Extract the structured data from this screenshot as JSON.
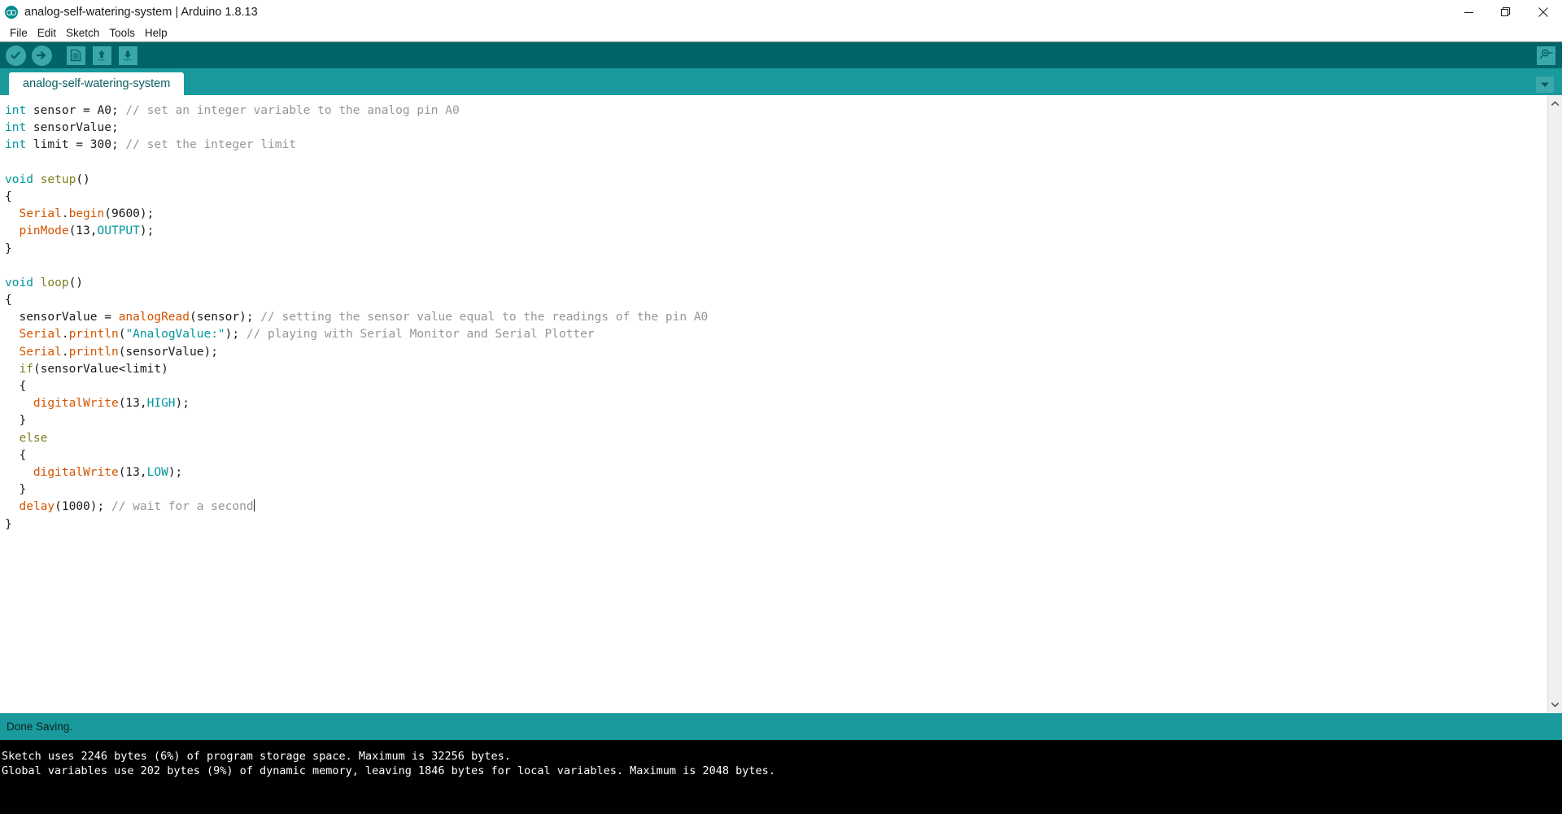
{
  "window": {
    "title": "analog-self-watering-system | Arduino 1.8.13",
    "logo_icon": "arduino-logo-icon",
    "controls": {
      "minimize": "minimize-icon",
      "restore": "restore-icon",
      "close": "close-icon"
    }
  },
  "menu": {
    "items": [
      {
        "label": "File"
      },
      {
        "label": "Edit"
      },
      {
        "label": "Sketch"
      },
      {
        "label": "Tools"
      },
      {
        "label": "Help"
      }
    ]
  },
  "toolbar": {
    "buttons": [
      {
        "name": "verify-button",
        "icon": "checkmark-icon",
        "label": "Verify"
      },
      {
        "name": "upload-button",
        "icon": "right-arrow-icon",
        "label": "Upload"
      },
      {
        "name": "new-button",
        "icon": "new-document-icon",
        "label": "New"
      },
      {
        "name": "open-button",
        "icon": "up-arrow-icon",
        "label": "Open"
      },
      {
        "name": "save-button",
        "icon": "down-arrow-icon",
        "label": "Save"
      }
    ],
    "serial_monitor": {
      "icon": "magnifier-icon",
      "label": "Serial Monitor"
    }
  },
  "tabs": {
    "items": [
      {
        "label": "analog-self-watering-system",
        "active": true
      }
    ],
    "dropdown_icon": "chevron-down-icon"
  },
  "editor": {
    "lines": [
      [
        {
          "t": "int",
          "c": "k-type"
        },
        {
          "t": " sensor = A0; ",
          "c": "k-plain"
        },
        {
          "t": "// set an integer variable to the analog pin A0",
          "c": "k-comment"
        }
      ],
      [
        {
          "t": "int",
          "c": "k-type"
        },
        {
          "t": " sensorValue;",
          "c": "k-plain"
        }
      ],
      [
        {
          "t": "int",
          "c": "k-type"
        },
        {
          "t": " limit = 300; ",
          "c": "k-plain"
        },
        {
          "t": "// set the integer limit",
          "c": "k-comment"
        }
      ],
      [],
      [
        {
          "t": "void",
          "c": "k-type"
        },
        {
          "t": " ",
          "c": "k-plain"
        },
        {
          "t": "setup",
          "c": "k-ctrl"
        },
        {
          "t": "()",
          "c": "k-plain"
        }
      ],
      [
        {
          "t": "{",
          "c": "k-plain"
        }
      ],
      [
        {
          "t": "  ",
          "c": "k-plain"
        },
        {
          "t": "Serial",
          "c": "k-func"
        },
        {
          "t": ".",
          "c": "k-plain"
        },
        {
          "t": "begin",
          "c": "k-func"
        },
        {
          "t": "(9600);",
          "c": "k-plain"
        }
      ],
      [
        {
          "t": "  ",
          "c": "k-plain"
        },
        {
          "t": "pinMode",
          "c": "k-func"
        },
        {
          "t": "(13,",
          "c": "k-plain"
        },
        {
          "t": "OUTPUT",
          "c": "k-const"
        },
        {
          "t": ");",
          "c": "k-plain"
        }
      ],
      [
        {
          "t": "}",
          "c": "k-plain"
        }
      ],
      [],
      [
        {
          "t": "void",
          "c": "k-type"
        },
        {
          "t": " ",
          "c": "k-plain"
        },
        {
          "t": "loop",
          "c": "k-ctrl"
        },
        {
          "t": "()",
          "c": "k-plain"
        }
      ],
      [
        {
          "t": "{",
          "c": "k-plain"
        }
      ],
      [
        {
          "t": "  sensorValue = ",
          "c": "k-plain"
        },
        {
          "t": "analogRead",
          "c": "k-func"
        },
        {
          "t": "(sensor); ",
          "c": "k-plain"
        },
        {
          "t": "// setting the sensor value equal to the readings of the pin A0",
          "c": "k-comment"
        }
      ],
      [
        {
          "t": "  ",
          "c": "k-plain"
        },
        {
          "t": "Serial",
          "c": "k-func"
        },
        {
          "t": ".",
          "c": "k-plain"
        },
        {
          "t": "println",
          "c": "k-func"
        },
        {
          "t": "(",
          "c": "k-plain"
        },
        {
          "t": "\"AnalogValue:\"",
          "c": "k-str"
        },
        {
          "t": "); ",
          "c": "k-plain"
        },
        {
          "t": "// playing with Serial Monitor and Serial Plotter",
          "c": "k-comment"
        }
      ],
      [
        {
          "t": "  ",
          "c": "k-plain"
        },
        {
          "t": "Serial",
          "c": "k-func"
        },
        {
          "t": ".",
          "c": "k-plain"
        },
        {
          "t": "println",
          "c": "k-func"
        },
        {
          "t": "(sensorValue);",
          "c": "k-plain"
        }
      ],
      [
        {
          "t": "  ",
          "c": "k-plain"
        },
        {
          "t": "if",
          "c": "k-ctrl"
        },
        {
          "t": "(sensorValue<limit)",
          "c": "k-plain"
        }
      ],
      [
        {
          "t": "  {",
          "c": "k-plain"
        }
      ],
      [
        {
          "t": "    ",
          "c": "k-plain"
        },
        {
          "t": "digitalWrite",
          "c": "k-func"
        },
        {
          "t": "(13,",
          "c": "k-plain"
        },
        {
          "t": "HIGH",
          "c": "k-const"
        },
        {
          "t": ");",
          "c": "k-plain"
        }
      ],
      [
        {
          "t": "  }",
          "c": "k-plain"
        }
      ],
      [
        {
          "t": "  ",
          "c": "k-plain"
        },
        {
          "t": "else",
          "c": "k-ctrl"
        }
      ],
      [
        {
          "t": "  {",
          "c": "k-plain"
        }
      ],
      [
        {
          "t": "    ",
          "c": "k-plain"
        },
        {
          "t": "digitalWrite",
          "c": "k-func"
        },
        {
          "t": "(13,",
          "c": "k-plain"
        },
        {
          "t": "LOW",
          "c": "k-const"
        },
        {
          "t": ");",
          "c": "k-plain"
        }
      ],
      [
        {
          "t": "  }",
          "c": "k-plain"
        }
      ],
      [
        {
          "t": "  ",
          "c": "k-plain"
        },
        {
          "t": "delay",
          "c": "k-func"
        },
        {
          "t": "(1000); ",
          "c": "k-plain"
        },
        {
          "t": "// wait for a second",
          "c": "k-comment"
        },
        {
          "t": "",
          "c": "caret-here"
        }
      ],
      [
        {
          "t": "}",
          "c": "k-plain"
        }
      ]
    ]
  },
  "scrollbar": {
    "up_icon": "chevron-up-icon",
    "down_icon": "chevron-down-icon"
  },
  "status": {
    "message": "Done Saving."
  },
  "console": {
    "lines": [
      "Sketch uses 2246 bytes (6%) of program storage space. Maximum is 32256 bytes.",
      "Global variables use 202 bytes (9%) of dynamic memory, leaving 1846 bytes for local variables. Maximum is 2048 bytes."
    ]
  },
  "colors": {
    "toolbar_bg": "#006468",
    "tabbar_bg": "#1a9a9c",
    "accent": "#3aa8ab",
    "console_bg": "#000000",
    "editor_bg": "#ffffff"
  }
}
